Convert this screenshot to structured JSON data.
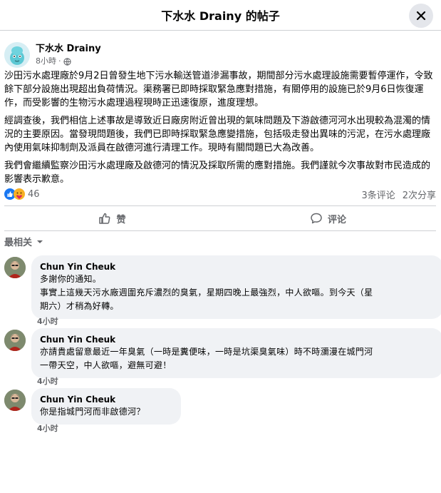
{
  "header": {
    "title": "下水水 Drainy 的帖子"
  },
  "post": {
    "author": "下水水 Drainy",
    "time": "8小時",
    "paragraphs": [
      "沙田污水處理廠於9月2日曾發生地下污水輸送管道滲漏事故，期間部分污水處理設施需要暫停運作，令致餘下部分設施出現超出負荷情況。渠務署已即時採取緊急應對措施，有關停用的設施已於9月6日恢復運作，而受影響的生物污水處理過程現時正迅速復原，進度理想。",
      "經調查後，我們相信上述事故是導致近日廠房附近曾出現的氣味問題及下游啟德河河水出現較為混濁的情況的主要原因。當發現問題後，我們已即時採取緊急應變措施，包括吸走發出異味的污泥，在污水處理廠內使用氣味抑制劑及派員在啟德河進行清理工作。現時有關問題已大為改善。",
      "我們會繼續監察沙田污水處理廠及啟德河的情況及採取所需的應對措施。我們謹就今次事故對市民造成的影響表示歉意。"
    ],
    "reactions_count": "46",
    "comments_count": "3条评论",
    "shares_count": "2次分享"
  },
  "actions": {
    "like": "赞",
    "comment": "评论"
  },
  "sort_label": "最相关",
  "comments": [
    {
      "name": "Chun Yin Cheuk",
      "lines": [
        "多謝你的通知。",
        "事實上這幾天污水廠週圍充斥濃烈的臭氣，星期四晚上最強烈，中人欲嘔。到今天（星",
        "期六）才稍為好轉。"
      ],
      "time": "4小时"
    },
    {
      "name": "Chun Yin Cheuk",
      "lines": [
        "亦請貴處留意最近一年臭氣（一時是糞便味，一時是坑渠臭氣味）時不時瀰漫在城門河",
        "一帶天空，中人欲嘔，避無可避！"
      ],
      "time": "4小时"
    },
    {
      "name": "Chun Yin Cheuk",
      "lines": [
        "你是指城門河而非啟德河？"
      ],
      "time": "4小时"
    }
  ],
  "colors": {
    "like_blue": "#1877f2",
    "muted": "#65676b",
    "bubble": "#f0f2f5"
  },
  "icons": {
    "close": "close-icon",
    "globe": "globe-icon",
    "like": "thumbs-up-icon",
    "comment": "comment-icon",
    "sort": "chevron-down-icon"
  }
}
